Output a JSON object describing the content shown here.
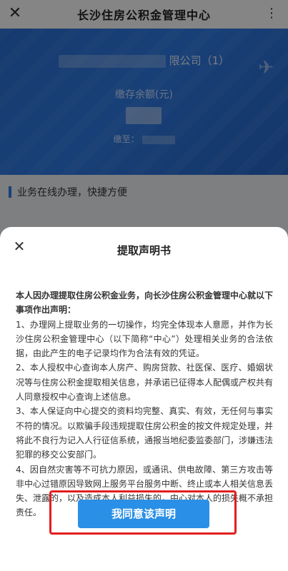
{
  "appbar": {
    "title": "长沙住房公积金管理中心"
  },
  "card": {
    "company_suffix": "限公司（1）",
    "balance_label": "缴存余额(元)",
    "deposit_label": "缴至："
  },
  "section": {
    "heading": "业务在线办理，快捷方便"
  },
  "dialog": {
    "title": "提取声明书",
    "intro": "本人因办理提取住房公积金业务，向长沙住房公积金管理中心就以下事项作出声明：",
    "items": [
      "1、办理网上提取业务的一切操作，均完全体现本人意愿，并作为长沙住房公积金管理中心（以下简称“中心”）处理相关业务的合法依据，由此产生的电子记录均作为合法有效的凭证。",
      "2、本人授权中心查询本人房产、购房贷款、社医保、医疗、婚姻状况等与住房公积金提取相关信息，并承诺已征得本人配偶或产权共有人同意授权中心查询上述信息。",
      "3、本人保证向中心提交的资料均完整、真实、有效，无任何与事实不符的情况。以欺骗手段违规提取住房公积金的按文件规定处理，并将此不良行为记入人行征信系统，通报当地纪委监委部门，涉嫌违法犯罪的移交公安部门。",
      "4、因自然灾害等不可抗力原因，或通讯、供电故障、第三方攻击等非中心过错原因导致网上服务平台服务中断、终止或本人相关信息丢失、泄露的，以及造成本人利益损失的，中心对本人的损失概不承担责任。"
    ],
    "agree_label": "我同意该声明"
  }
}
